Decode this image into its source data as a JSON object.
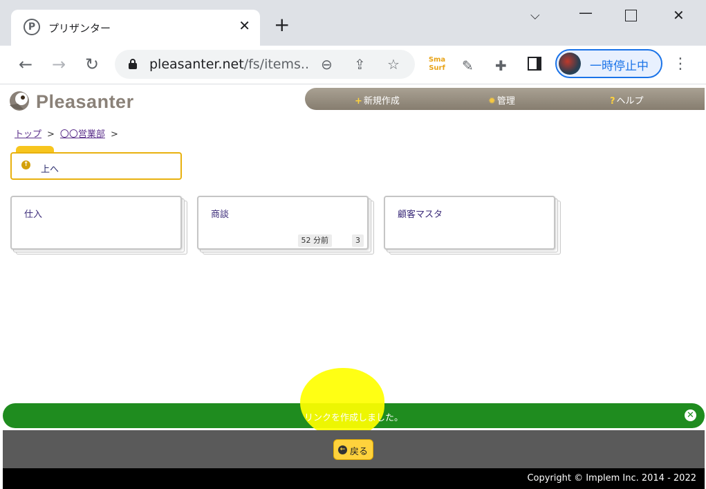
{
  "browser": {
    "tab_title": "プリザンター",
    "favicon_letter": "P",
    "url_domain": "pleasanter.net",
    "url_path": "/fs/items...",
    "profile_label": "一時停止中",
    "extensions": [
      "zoom-out-icon",
      "share-icon",
      "star-icon",
      "smartsurf-icon",
      "notes-icon",
      "puzzle-icon",
      "side-panel-icon"
    ],
    "smartsurf_text": "Sma Surf"
  },
  "app": {
    "logo_text": "Pleasanter",
    "nav": [
      {
        "prefix": "+",
        "label": "新規作成"
      },
      {
        "prefix": "✹",
        "label": "管理"
      },
      {
        "prefix": "?",
        "label": "ヘルプ"
      }
    ],
    "breadcrumb": [
      {
        "label": "トップ"
      },
      {
        "label": "〇〇営業部"
      }
    ],
    "breadcrumb_sep": ">",
    "up_label": "上へ",
    "cards": [
      {
        "title": "仕入",
        "time": "",
        "count": ""
      },
      {
        "title": "商談",
        "time": "52 分前",
        "count": "3"
      },
      {
        "title": "顧客マスタ",
        "time": "",
        "count": ""
      }
    ],
    "toast_message": "リンクを作成しました。",
    "back_label": "戻る",
    "copyright": "Copyright © Implem Inc. 2014 - 2022"
  },
  "colors": {
    "toast_green": "#1f8c1f",
    "accent_yellow": "#ffd23c",
    "nav_bar": "#958d80",
    "highlight": "#ffff00"
  }
}
